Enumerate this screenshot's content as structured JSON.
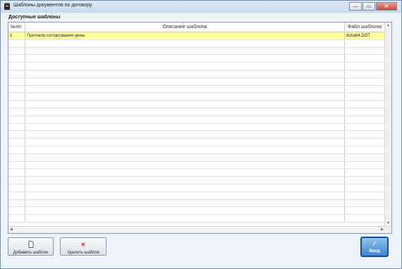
{
  "window": {
    "title": "Шаблоны документов по договору",
    "minimize_glyph": "—",
    "maximize_glyph": "▭",
    "close_glyph": "✕"
  },
  "section_label": "Доступные шаблоны",
  "table": {
    "columns": [
      "№пп",
      "Описание шаблона",
      "Файл шаблона"
    ],
    "rows": [
      {
        "num": "1",
        "description": "Протокол согласования цены",
        "file": "dshab4.DOT",
        "selected": true
      },
      {
        "num": "",
        "description": "",
        "file": ""
      },
      {
        "num": "",
        "description": "",
        "file": ""
      },
      {
        "num": "",
        "description": "",
        "file": ""
      },
      {
        "num": "",
        "description": "",
        "file": ""
      },
      {
        "num": "",
        "description": "",
        "file": ""
      },
      {
        "num": "",
        "description": "",
        "file": ""
      },
      {
        "num": "",
        "description": "",
        "file": ""
      },
      {
        "num": "",
        "description": "",
        "file": ""
      },
      {
        "num": "",
        "description": "",
        "file": ""
      },
      {
        "num": "",
        "description": "",
        "file": ""
      },
      {
        "num": "",
        "description": "",
        "file": ""
      },
      {
        "num": "",
        "description": "",
        "file": ""
      },
      {
        "num": "",
        "description": "",
        "file": ""
      },
      {
        "num": "",
        "description": "",
        "file": ""
      },
      {
        "num": "",
        "description": "",
        "file": ""
      },
      {
        "num": "",
        "description": "",
        "file": ""
      },
      {
        "num": "",
        "description": "",
        "file": ""
      },
      {
        "num": "",
        "description": "",
        "file": ""
      },
      {
        "num": "",
        "description": "",
        "file": ""
      },
      {
        "num": "",
        "description": "",
        "file": ""
      },
      {
        "num": "",
        "description": "",
        "file": ""
      },
      {
        "num": "",
        "description": "",
        "file": ""
      },
      {
        "num": "",
        "description": "",
        "file": ""
      },
      {
        "num": "",
        "description": "",
        "file": ""
      }
    ]
  },
  "buttons": {
    "add": {
      "label": "Добавить шаблон",
      "icon": "document-icon"
    },
    "delete": {
      "label": "Удалить шаблон",
      "icon": "red-x-icon"
    },
    "enter": {
      "label": "Ввод",
      "icon": "checkmark-icon"
    }
  },
  "colors": {
    "selected_row": "#ffff9c",
    "delete_icon": "#cc1f1f",
    "enter_button": "#3f86cf"
  }
}
